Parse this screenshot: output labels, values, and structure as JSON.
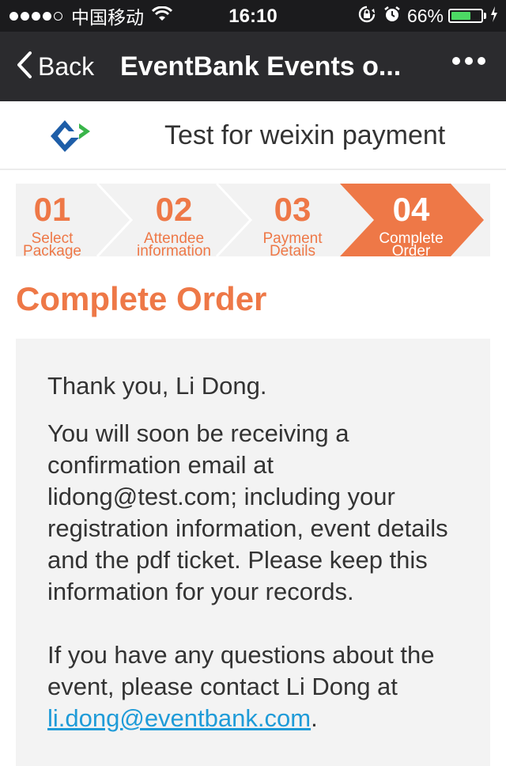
{
  "status_bar": {
    "carrier": "中国移动",
    "time": "16:10",
    "battery_percent": "66%",
    "battery_level": 0.66,
    "signal_bars_filled": 4,
    "signal_bars_total": 5
  },
  "nav": {
    "back_label": "Back",
    "title": "EventBank Events o..."
  },
  "header": {
    "site_title": "Test for weixin payment"
  },
  "steps": [
    {
      "number": "01",
      "line1": "Select",
      "line2": "Package",
      "active": false
    },
    {
      "number": "02",
      "line1": "Attendee",
      "line2": "information",
      "active": false
    },
    {
      "number": "03",
      "line1": "Payment",
      "line2": "Details",
      "active": false
    },
    {
      "number": "04",
      "line1": "Complete",
      "line2": "Order",
      "active": true
    }
  ],
  "page": {
    "heading": "Complete Order",
    "thanks": "Thank you, Li Dong.",
    "body": "You will soon be receiving a confirmation email at lidong@test.com; including your registration information, event details and the pdf ticket. Please keep this information for your records.",
    "contact_prefix": "If you have any questions about the event, please contact Li Dong at ",
    "contact_email": "li.dong@eventbank.com",
    "contact_suffix": "."
  },
  "colors": {
    "accent": "#ee7847",
    "nav_bg": "#2b2b2e",
    "link": "#1f9bd8",
    "step_bg": "#f2f2f2"
  }
}
